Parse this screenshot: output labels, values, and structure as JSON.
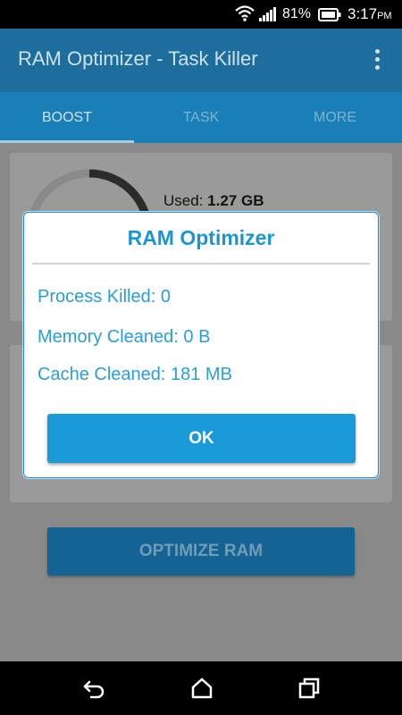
{
  "status_bar": {
    "battery_percent": "81%",
    "time": "3:17",
    "ampm": "PM",
    "icons": [
      "wifi-icon",
      "signal-icon",
      "battery-icon"
    ]
  },
  "app_bar": {
    "title": "RAM Optimizer - Task Killer",
    "menu_icon": "overflow-menu-icon"
  },
  "tabs": [
    {
      "label": "BOOST",
      "active": true
    },
    {
      "label": "TASK",
      "active": false
    },
    {
      "label": "MORE",
      "active": false
    }
  ],
  "memory_card": {
    "used_label": "Used:",
    "used_value": "1.27 GB"
  },
  "optimize_button": {
    "label": "OPTIMIZE RAM"
  },
  "dialog": {
    "title": "RAM Optimizer",
    "lines": [
      "Process Killed: 0",
      "Memory Cleaned: 0 B",
      "Cache Cleaned: 181 MB"
    ],
    "ok_label": "OK"
  },
  "nav_bar": {
    "icons": [
      "back-icon",
      "home-icon",
      "recents-icon"
    ]
  },
  "colors": {
    "app_bar": "#1d6e9d",
    "tab_bar": "#1a7fb6",
    "dialog_accent": "#1a95d2",
    "ok_button": "#1a9ad9"
  }
}
